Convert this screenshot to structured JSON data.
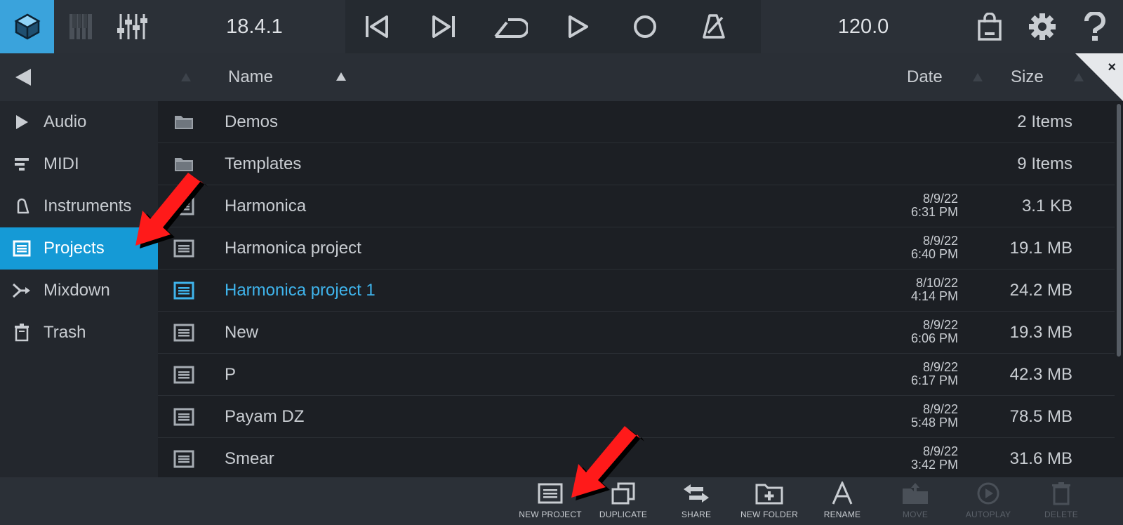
{
  "toolbar": {
    "version": "18.4.1",
    "tempo": "120.0",
    "icons": [
      "app-logo-icon",
      "keyboard-icon",
      "mixer-icon",
      "skip-back-icon",
      "skip-forward-icon",
      "loop-icon",
      "play-icon",
      "record-icon",
      "metronome-icon",
      "shop-icon",
      "gear-icon",
      "help-icon"
    ]
  },
  "header": {
    "name_label": "Name",
    "date_label": "Date",
    "size_label": "Size",
    "close_label": "×"
  },
  "sidebar": {
    "items": [
      {
        "label": "Audio",
        "icon": "play-outline-icon"
      },
      {
        "label": "MIDI",
        "icon": "midi-bars-icon"
      },
      {
        "label": "Instruments",
        "icon": "bell-icon"
      },
      {
        "label": "Projects",
        "icon": "project-list-icon",
        "active": true
      },
      {
        "label": "Mixdown",
        "icon": "mixdown-icon"
      },
      {
        "label": "Trash",
        "icon": "trash-icon"
      }
    ]
  },
  "files": [
    {
      "name": "Demos",
      "date_line1": "",
      "date_line2": "",
      "size": "2 Items",
      "type": "folder"
    },
    {
      "name": "Templates",
      "date_line1": "",
      "date_line2": "",
      "size": "9 Items",
      "type": "folder"
    },
    {
      "name": "Harmonica",
      "date_line1": "8/9/22",
      "date_line2": "6:31 PM",
      "size": "3.1 KB",
      "type": "project"
    },
    {
      "name": "Harmonica project",
      "date_line1": "8/9/22",
      "date_line2": "6:40 PM",
      "size": "19.1 MB",
      "type": "project"
    },
    {
      "name": "Harmonica project 1",
      "date_line1": "8/10/22",
      "date_line2": "4:14 PM",
      "size": "24.2 MB",
      "type": "project",
      "selected": true
    },
    {
      "name": "New",
      "date_line1": "8/9/22",
      "date_line2": "6:06 PM",
      "size": "19.3 MB",
      "type": "project"
    },
    {
      "name": "P",
      "date_line1": "8/9/22",
      "date_line2": "6:17 PM",
      "size": "42.3 MB",
      "type": "project"
    },
    {
      "name": "Payam DZ",
      "date_line1": "8/9/22",
      "date_line2": "5:48 PM",
      "size": "78.5 MB",
      "type": "project"
    },
    {
      "name": "Smear",
      "date_line1": "8/9/22",
      "date_line2": "3:42 PM",
      "size": "31.6 MB",
      "type": "project"
    }
  ],
  "actions": [
    {
      "label": "NEW PROJECT",
      "icon": "new-project-icon",
      "enabled": true
    },
    {
      "label": "DUPLICATE",
      "icon": "duplicate-icon",
      "enabled": true
    },
    {
      "label": "SHARE",
      "icon": "share-icon",
      "enabled": true
    },
    {
      "label": "NEW FOLDER",
      "icon": "new-folder-icon",
      "enabled": true
    },
    {
      "label": "RENAME",
      "icon": "rename-icon",
      "enabled": true
    },
    {
      "label": "MOVE",
      "icon": "move-icon",
      "enabled": false
    },
    {
      "label": "AUTOPLAY",
      "icon": "autoplay-icon",
      "enabled": false
    },
    {
      "label": "DELETE",
      "icon": "delete-icon",
      "enabled": false
    }
  ],
  "colors": {
    "accent": "#159ad6",
    "selected_text": "#3fb4ec",
    "annotation_arrow": "#ff0000"
  }
}
